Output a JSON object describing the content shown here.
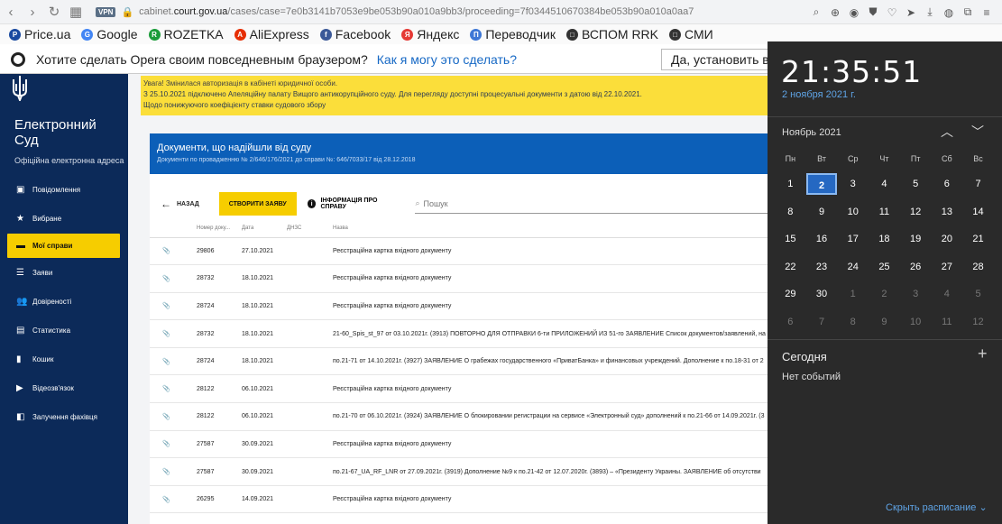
{
  "browser": {
    "url_prefix": "cabinet.",
    "url_domain": "court.gov.ua",
    "url_path": "/cases/case=7e0b3141b7053e9be053b90a010a9bb3/proceeding=7f0344510670384be053b90a010a0aa7",
    "vpn": "VPN",
    "bookmarks": [
      {
        "label": "Price.ua",
        "color": "#1a4aa0",
        "glyph": "P"
      },
      {
        "label": "Google",
        "color": "#4285f4",
        "glyph": "G"
      },
      {
        "label": "ROZETKA",
        "color": "#1b9c3a",
        "glyph": "R"
      },
      {
        "label": "AliExpress",
        "color": "#e62e04",
        "glyph": "A"
      },
      {
        "label": "Facebook",
        "color": "#3b5998",
        "glyph": "f"
      },
      {
        "label": "Яндекс",
        "color": "#e53935",
        "glyph": "Я"
      },
      {
        "label": "Переводчик",
        "color": "#3d77d6",
        "glyph": "П"
      },
      {
        "label": "ВСПОМ RRK",
        "color": "#333333",
        "glyph": "□"
      },
      {
        "label": "СМИ",
        "color": "#333333",
        "glyph": "□"
      }
    ]
  },
  "opera": {
    "message": "Хотите сделать Opera своим повседневным браузером?",
    "link": "Как я могу это сделать?",
    "button": "Да, установить в"
  },
  "sidebar": {
    "brand_line1": "Електронний",
    "brand_line2": "Суд",
    "subtitle": "Офіційна електронна адреса",
    "items": [
      {
        "label": "Повідомлення",
        "icon": "message-icon",
        "glyph": "▣"
      },
      {
        "label": "Вибране",
        "icon": "star-icon",
        "glyph": "★"
      },
      {
        "label": "Мої справи",
        "icon": "folder-icon",
        "glyph": "▬"
      },
      {
        "label": "Заяви",
        "icon": "list-icon",
        "glyph": "☰"
      },
      {
        "label": "Довіреності",
        "icon": "users-icon",
        "glyph": "👥"
      },
      {
        "label": "Статистика",
        "icon": "chart-icon",
        "glyph": "▤"
      },
      {
        "label": "Кошик",
        "icon": "trash-icon",
        "glyph": "▮"
      },
      {
        "label": "Відеозв'язок",
        "icon": "video-icon",
        "glyph": "▶"
      },
      {
        "label": "Залучення фахівця",
        "icon": "expert-icon",
        "glyph": "◧"
      }
    ]
  },
  "alert": {
    "line1": "Увага! Змінилася авторизація в кабінеті юридичної особи.",
    "line2": "З 25.10.2021 підключено Апеляційну палату Вищого антикорупційного суду. Для перегляду доступні процесуальні документи з датою від 22.10.2021.",
    "line3": "Щодо понижуючого коефіцієнту ставки судового збору"
  },
  "card": {
    "title": "Документи, що надійшли від суду",
    "subtitle": "Документи по провадженню № 2/646/176/2021 до справи №: 646/7033/17 від 28.12.2018",
    "back": "НАЗАД",
    "create": "СТВОРИТИ ЗАЯВУ",
    "info": "ІНФОРМАЦІЯ ПРО СПРАВУ",
    "search_placeholder": "Пошук"
  },
  "table": {
    "headers": [
      "Номер доку...",
      "Дата",
      "ДНЗС",
      "Назва"
    ],
    "rows": [
      {
        "num": "29806",
        "date": "27.10.2021",
        "dnzs": "",
        "name": "Реєстраційна картка вхідного документу"
      },
      {
        "num": "28732",
        "date": "18.10.2021",
        "dnzs": "",
        "name": "Реєстраційна картка вхідного документу"
      },
      {
        "num": "28724",
        "date": "18.10.2021",
        "dnzs": "",
        "name": "Реєстраційна картка вхідного документу"
      },
      {
        "num": "28732",
        "date": "18.10.2021",
        "dnzs": "",
        "name": "21-60_Spis_st_97 от 03.10.2021г. (3913) ПОВТОРНО ДЛЯ ОТПРАВКИ 6-ти ПРИЛОЖЕНИЙ ИЗ 51-го ЗАЯВЛЕНИЕ Список документов/заявлений, на"
      },
      {
        "num": "28724",
        "date": "18.10.2021",
        "dnzs": "",
        "name": "по.21-71 от 14.10.2021г. (3927) ЗАЯВЛЕНИЕ О грабежах государственного «ПриватБанка» и финансовых учреждений. Дополнение к по.18-31 от 2"
      },
      {
        "num": "28122",
        "date": "06.10.2021",
        "dnzs": "",
        "name": "Реєстраційна картка вхідного документу"
      },
      {
        "num": "28122",
        "date": "06.10.2021",
        "dnzs": "",
        "name": "по.21-70 от 06.10.2021г. (3924) ЗАЯВЛЕНИЕ О блокировании регистрации на сервисе «Электронный суд» дополнений к по.21-66 от 14.09.2021г. (3"
      },
      {
        "num": "27587",
        "date": "30.09.2021",
        "dnzs": "",
        "name": "Реєстраційна картка вхідного документу"
      },
      {
        "num": "27587",
        "date": "30.09.2021",
        "dnzs": "",
        "name": "по.21-67_UA_RF_LNR от 27.09.2021г. (3919) Дополнение №9 к по.21-42 от 12.07.2020г. (3893) – «Президенту Украины. ЗАЯВЛЕНИЕ об отсутстви"
      },
      {
        "num": "26295",
        "date": "14.09.2021",
        "dnzs": "",
        "name": "Реєстраційна картка вхідного документу"
      }
    ]
  },
  "calendar": {
    "time": "21:35:51",
    "date": "2 ноября 2021 г.",
    "month": "Ноябрь 2021",
    "weekdays": [
      "Пн",
      "Вт",
      "Ср",
      "Чт",
      "Пт",
      "Сб",
      "Вс"
    ],
    "weeks": [
      [
        "1",
        "2",
        "3",
        "4",
        "5",
        "6",
        "7"
      ],
      [
        "8",
        "9",
        "10",
        "11",
        "12",
        "13",
        "14"
      ],
      [
        "15",
        "16",
        "17",
        "18",
        "19",
        "20",
        "21"
      ],
      [
        "22",
        "23",
        "24",
        "25",
        "26",
        "27",
        "28"
      ],
      [
        "29",
        "30",
        "1",
        "2",
        "3",
        "4",
        "5"
      ],
      [
        "6",
        "7",
        "8",
        "9",
        "10",
        "11",
        "12"
      ]
    ],
    "today_index": [
      0,
      1
    ],
    "today_label": "Сегодня",
    "no_events": "Нет событий",
    "hide_schedule": "Скрыть расписание",
    "accent": "#2568c2"
  }
}
